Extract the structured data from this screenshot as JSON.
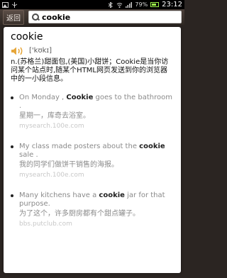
{
  "status_bar": {
    "battery": "79%",
    "time": "23:12"
  },
  "toolbar": {
    "back_label": "返回",
    "search_value": "cookie"
  },
  "entry": {
    "word": "cookie",
    "phonetic": "['kʊkɪ]",
    "definition": "n.(苏格兰)甜面包,(美国)小甜饼；Cookie是当你访问某个站点时,随某个HTML网页发送到你的浏览器中的一小段信息。",
    "examples": [
      {
        "en_before": "On Monday , ",
        "en_bold": "Cookie",
        "en_after": " goes to the bathroom .",
        "zh": "星期一，库奇去浴室。",
        "source": "mysearch.100e.com"
      },
      {
        "en_before": "My class made posters about the ",
        "en_bold": "cookie",
        "en_after": " sale .",
        "zh": "我的同学们做饼干销售的海报。",
        "source": "mysearch.100e.com"
      },
      {
        "en_before": "Many kitchens have a ",
        "en_bold": "cookie",
        "en_after": " jar for that purpose.",
        "zh": "为了这个，许多厨房都有个甜点罐子。",
        "source": "bbs.putclub.com"
      }
    ]
  },
  "colors": {
    "toolbar_bg": "#3a312c",
    "card_bg": "#ffffff",
    "speaker_accent": "#e6a63a"
  },
  "icons": [
    "search-icon",
    "speaker-icon",
    "battery-icon",
    "signal-icon",
    "wifi-icon"
  ]
}
